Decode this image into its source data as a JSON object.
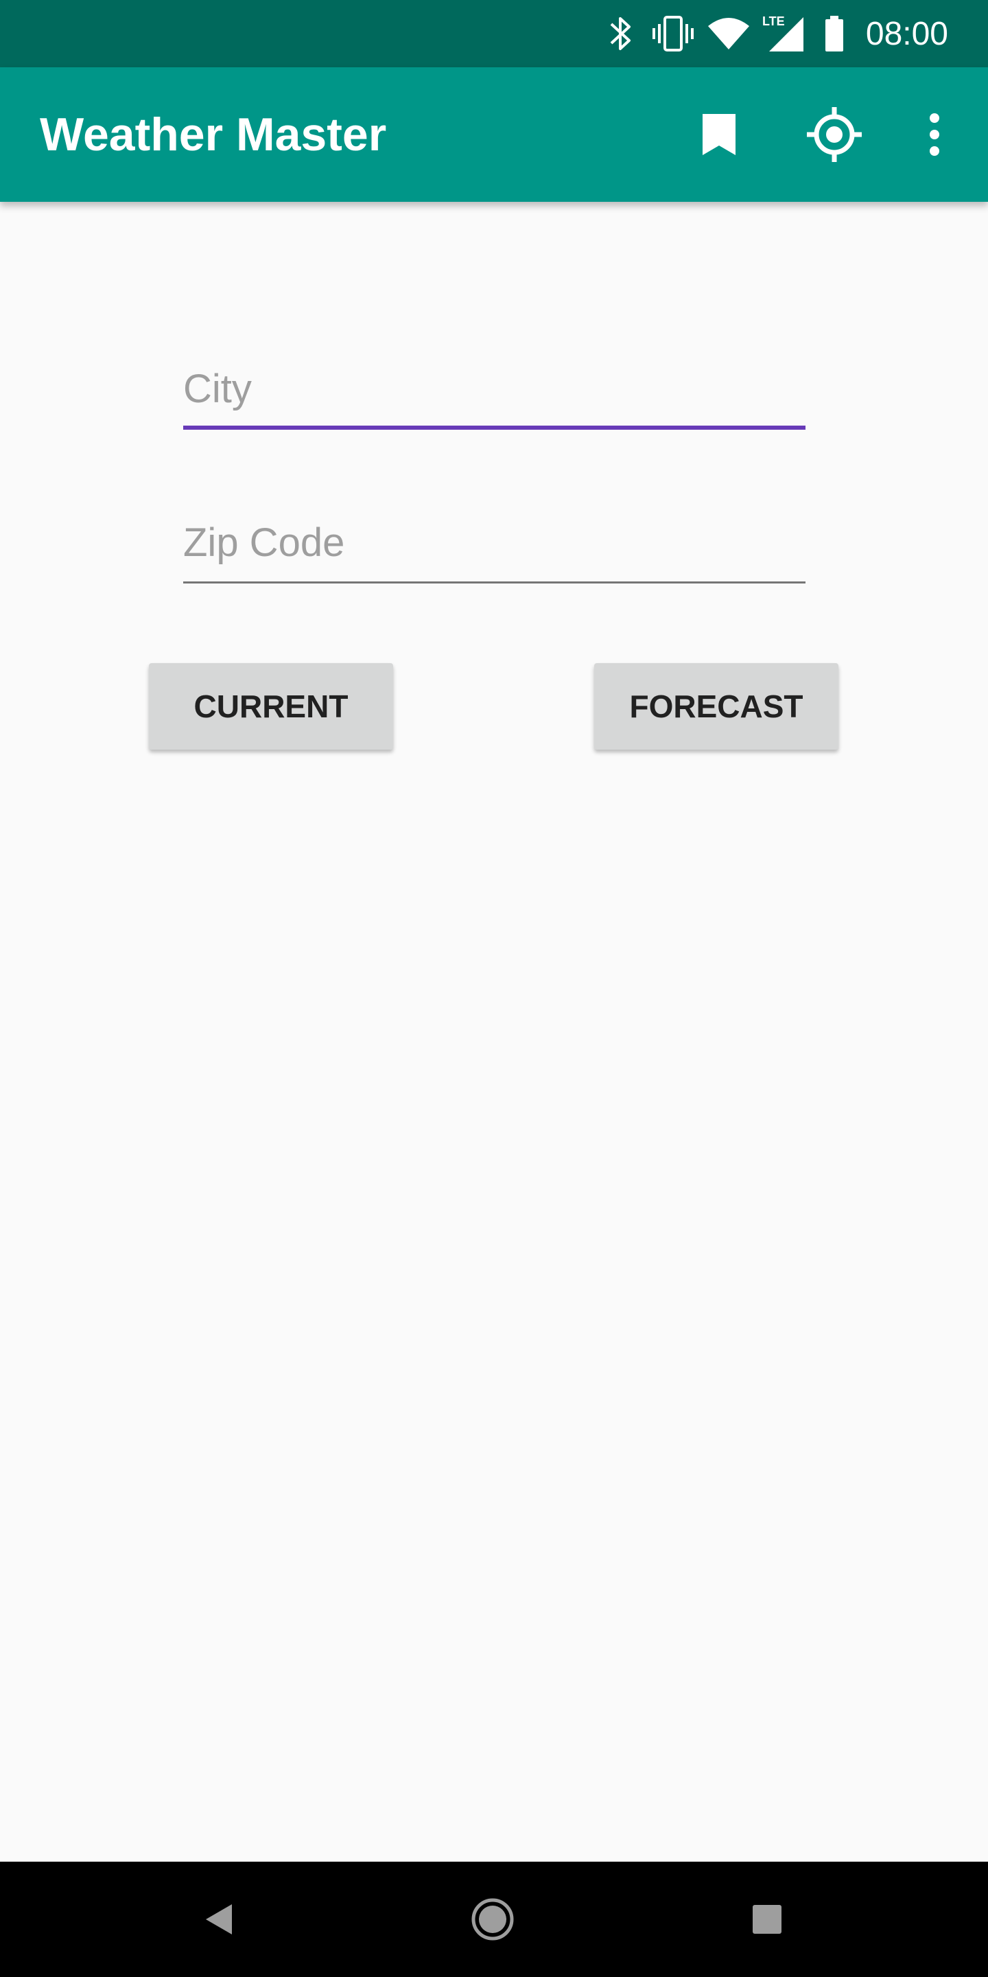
{
  "status_bar": {
    "time": "08:00",
    "lte_label": "LTE",
    "icons": [
      "bluetooth-icon",
      "vibrate-icon",
      "wifi-icon",
      "lte-signal-icon",
      "battery-icon"
    ]
  },
  "app_bar": {
    "title": "Weather Master",
    "actions": [
      "bookmark-icon",
      "my-location-icon",
      "overflow-menu-icon"
    ]
  },
  "form": {
    "city": {
      "placeholder": "City",
      "value": ""
    },
    "zip": {
      "placeholder": "Zip Code",
      "value": ""
    }
  },
  "buttons": {
    "current_label": "CURRENT",
    "forecast_label": "FORECAST"
  },
  "nav_bar": {
    "icons": [
      "back-icon",
      "home-icon",
      "recents-icon"
    ]
  },
  "colors": {
    "status_bar": "#00695c",
    "app_bar": "#009688",
    "accent": "#673ab7",
    "button": "#d6d7d7",
    "background": "#fafafa"
  }
}
